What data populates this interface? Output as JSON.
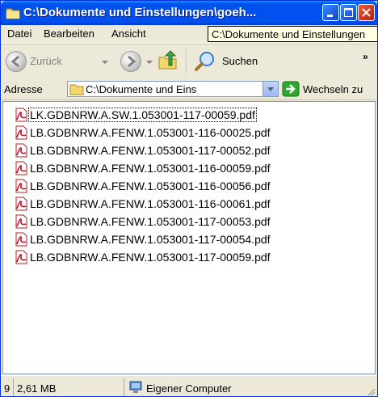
{
  "window": {
    "title": "C:\\Dokumente und Einstellungen\\goeh...",
    "controls": {
      "minimize": "_",
      "maximize": "□",
      "close": "×"
    }
  },
  "menu": {
    "items": [
      "Datei",
      "Bearbeiten",
      "Ansicht"
    ],
    "tooltip": "C:\\Dokumente und Einstellungen"
  },
  "toolbar": {
    "back_label": "Zurück",
    "search_label": "Suchen",
    "chevron": "»"
  },
  "address": {
    "label": "Adresse",
    "value": "C:\\Dokumente und Eins",
    "go_label": "Wechseln zu"
  },
  "files": [
    "LK.GDBNRW.A.SW.1.053001-117-00059.pdf",
    "LB.GDBNRW.A.FENW.1.053001-116-00025.pdf",
    "LB.GDBNRW.A.FENW.1.053001-117-00052.pdf",
    "LB.GDBNRW.A.FENW.1.053001-116-00059.pdf",
    "LB.GDBNRW.A.FENW.1.053001-116-00056.pdf",
    "LB.GDBNRW.A.FENW.1.053001-116-00061.pdf",
    "LB.GDBNRW.A.FENW.1.053001-117-00053.pdf",
    "LB.GDBNRW.A.FENW.1.053001-117-00054.pdf",
    "LB.GDBNRW.A.FENW.1.053001-117-00059.pdf"
  ],
  "status": {
    "count": "9",
    "size": "2,61 MB",
    "location": "Eigener Computer"
  },
  "icons": {
    "title": "folder-icon",
    "file": "pdf-file-icon",
    "back": "back-arrow-icon",
    "forward": "forward-arrow-icon",
    "up": "folder-up-icon",
    "search": "search-icon",
    "go": "go-arrow-icon",
    "computer": "my-computer-icon"
  },
  "colors": {
    "titlebar": "#0053EE",
    "chrome": "#ECE9D8",
    "accent_close": "#C8391F"
  }
}
